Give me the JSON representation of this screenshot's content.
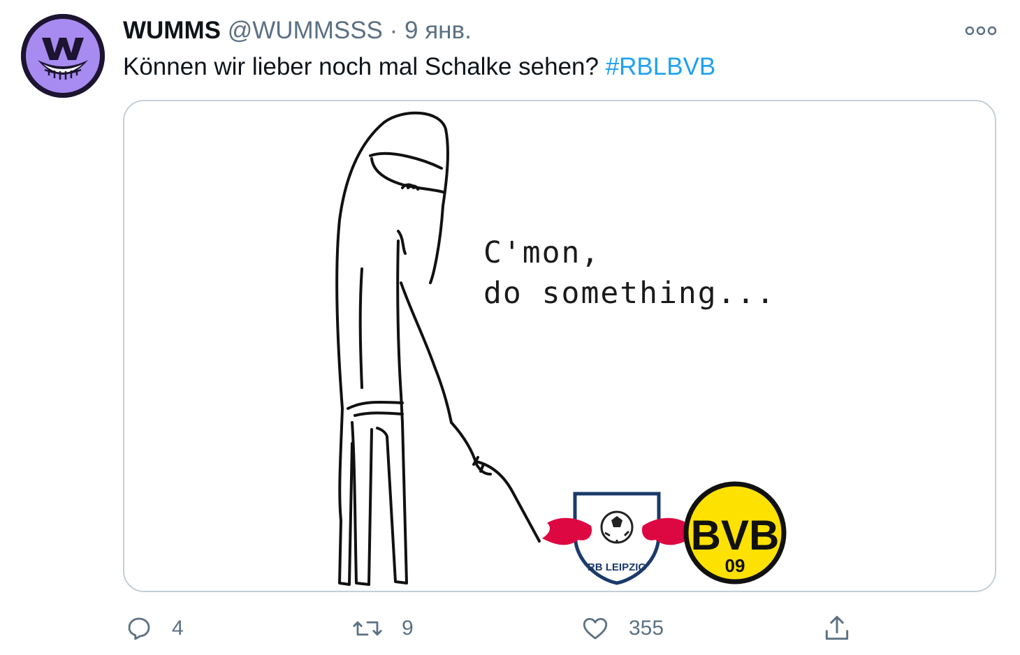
{
  "tweet": {
    "display_name": "WUMMS",
    "handle": "@WUMMSSS",
    "separator": "·",
    "date": "9 янв.",
    "avatar_icon": "wumms-grin-logo",
    "text": "Können wir lieber noch mal Schalke sehen? ",
    "hashtag": "#RBLBVB"
  },
  "media": {
    "caption": "C'mon,\ndo something...",
    "badges": {
      "rb_text": "RB LEIPZIG",
      "bvb_top": "BVB",
      "bvb_bottom": "09"
    }
  },
  "actions": {
    "reply": {
      "icon": "reply-icon",
      "count": "4"
    },
    "retweet": {
      "icon": "retweet-icon",
      "count": "9"
    },
    "like": {
      "icon": "heart-icon",
      "count": "355"
    },
    "share": {
      "icon": "share-icon"
    }
  },
  "colors": {
    "hashtag": "#1da1f2",
    "muted": "#5b7083",
    "avatar_purple": "#a78bf0",
    "bvb_yellow": "#fde100",
    "rb_red": "#dd0741"
  }
}
